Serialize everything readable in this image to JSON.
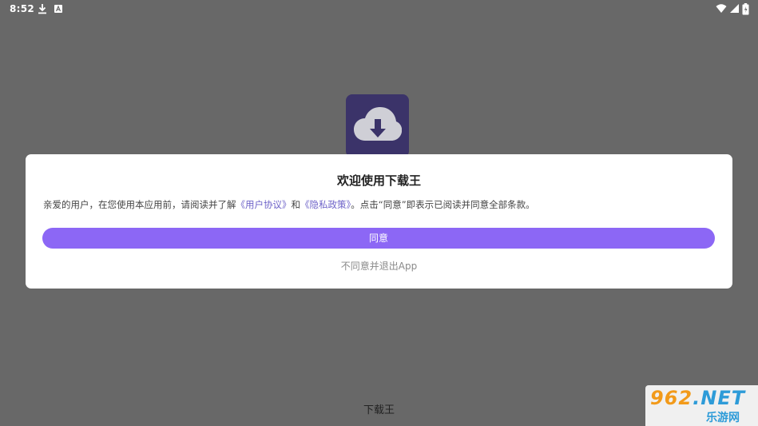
{
  "status_bar": {
    "time": "8:52",
    "left_icons": [
      "download-icon",
      "notification-icon"
    ],
    "right_icons": [
      "wifi-icon",
      "signal-icon",
      "battery-icon"
    ]
  },
  "app_icon": {
    "icon": "cloud-download-icon",
    "bg_color": "#3b3369"
  },
  "dialog": {
    "title": "欢迎使用下载王",
    "body_prefix": "亲爱的用户，在您使用本应用前，请阅读并了解",
    "user_agreement_link": "《用户协议》",
    "conjunction": "和",
    "privacy_policy_link": "《隐私政策》",
    "body_suffix": "。点击“同意”即表示已阅读并同意全部条款。",
    "agree_button": "同意",
    "disagree_link": "不同意并退出App",
    "accent_color": "#8c67f5"
  },
  "bottom_app_name": "下载王",
  "watermark": {
    "main_text_prefix": "962",
    "main_text_suffix": ".NET",
    "sub_text": "乐游网"
  }
}
